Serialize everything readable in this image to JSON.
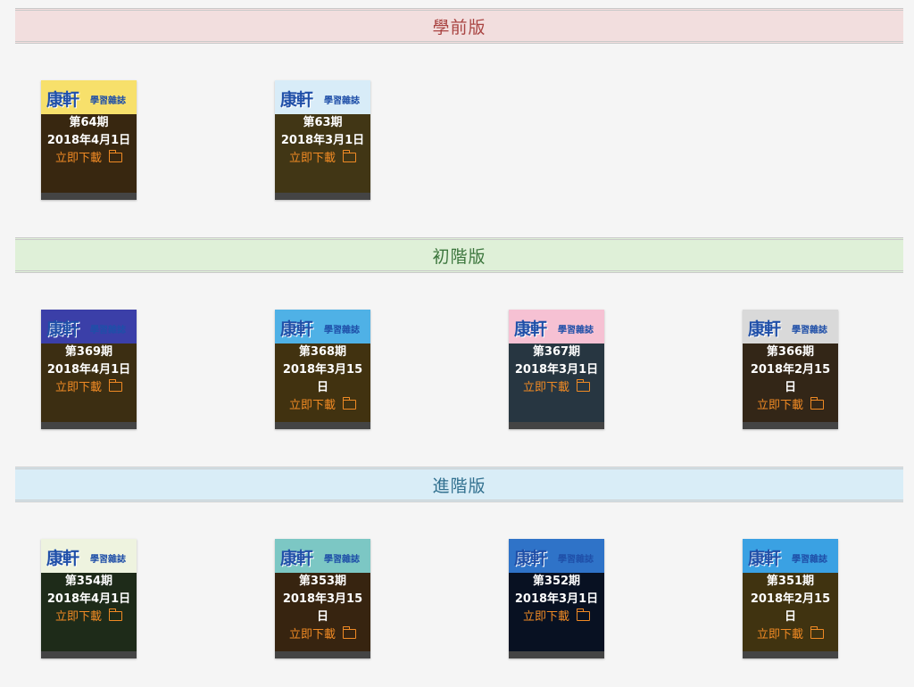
{
  "sections": [
    {
      "title": "學前版",
      "cards": [
        {
          "issue": "第64期",
          "date": "2018年4月1日",
          "download": "立即下載",
          "logo": "康軒",
          "logo_sub": "學習雜誌",
          "banner_color": "#f7e06b",
          "scene_color": "#c98c3c"
        },
        {
          "issue": "第63期",
          "date": "2018年3月1日",
          "download": "立即下載",
          "logo": "康軒",
          "logo_sub": "學習雜誌",
          "banner_color": "#d8ecf8",
          "scene_color": "#e9c34e"
        }
      ]
    },
    {
      "title": "初階版",
      "cards": [
        {
          "issue": "第369期",
          "date": "2018年4月1日",
          "download": "立即下載",
          "logo": "康軒",
          "logo_sub": "學習雜誌",
          "banner_color": "#3b3fa8",
          "scene_color": "#d6a542"
        },
        {
          "issue": "第368期",
          "date": "2018年3月15日",
          "download": "立即下載",
          "logo": "康軒",
          "logo_sub": "學習雜誌",
          "banner_color": "#4fb1e6",
          "scene_color": "#e9b23c"
        },
        {
          "issue": "第367期",
          "date": "2018年3月1日",
          "download": "立即下載",
          "logo": "康軒",
          "logo_sub": "學習雜誌",
          "banner_color": "#f6c1d3",
          "scene_color": "#8bc2e8"
        },
        {
          "issue": "第366期",
          "date": "2018年2月15日",
          "download": "立即下載",
          "logo": "康軒",
          "logo_sub": "學習雜誌",
          "banner_color": "#d9d9d9",
          "scene_color": "#b88a52"
        }
      ]
    },
    {
      "title": "進階版",
      "cards": [
        {
          "issue": "第354期",
          "date": "2018年4月1日",
          "download": "立即下載",
          "logo": "康軒",
          "logo_sub": "學習雜誌",
          "banner_color": "#eef3df",
          "scene_color": "#6e9b5a"
        },
        {
          "issue": "第353期",
          "date": "2018年3月15日",
          "download": "立即下載",
          "logo": "康軒",
          "logo_sub": "學習雜誌",
          "banner_color": "#7cc7c4",
          "scene_color": "#c4803c"
        },
        {
          "issue": "第352期",
          "date": "2018年3月1日",
          "download": "立即下載",
          "logo": "康軒",
          "logo_sub": "學習雜誌",
          "banner_color": "#2f73c8",
          "scene_color": "#1e3f7a"
        },
        {
          "issue": "第351期",
          "date": "2018年2月15日",
          "download": "立即下載",
          "logo": "康軒",
          "logo_sub": "學習雜誌",
          "banner_color": "#3aa1e3",
          "scene_color": "#e6b83c"
        }
      ]
    }
  ]
}
